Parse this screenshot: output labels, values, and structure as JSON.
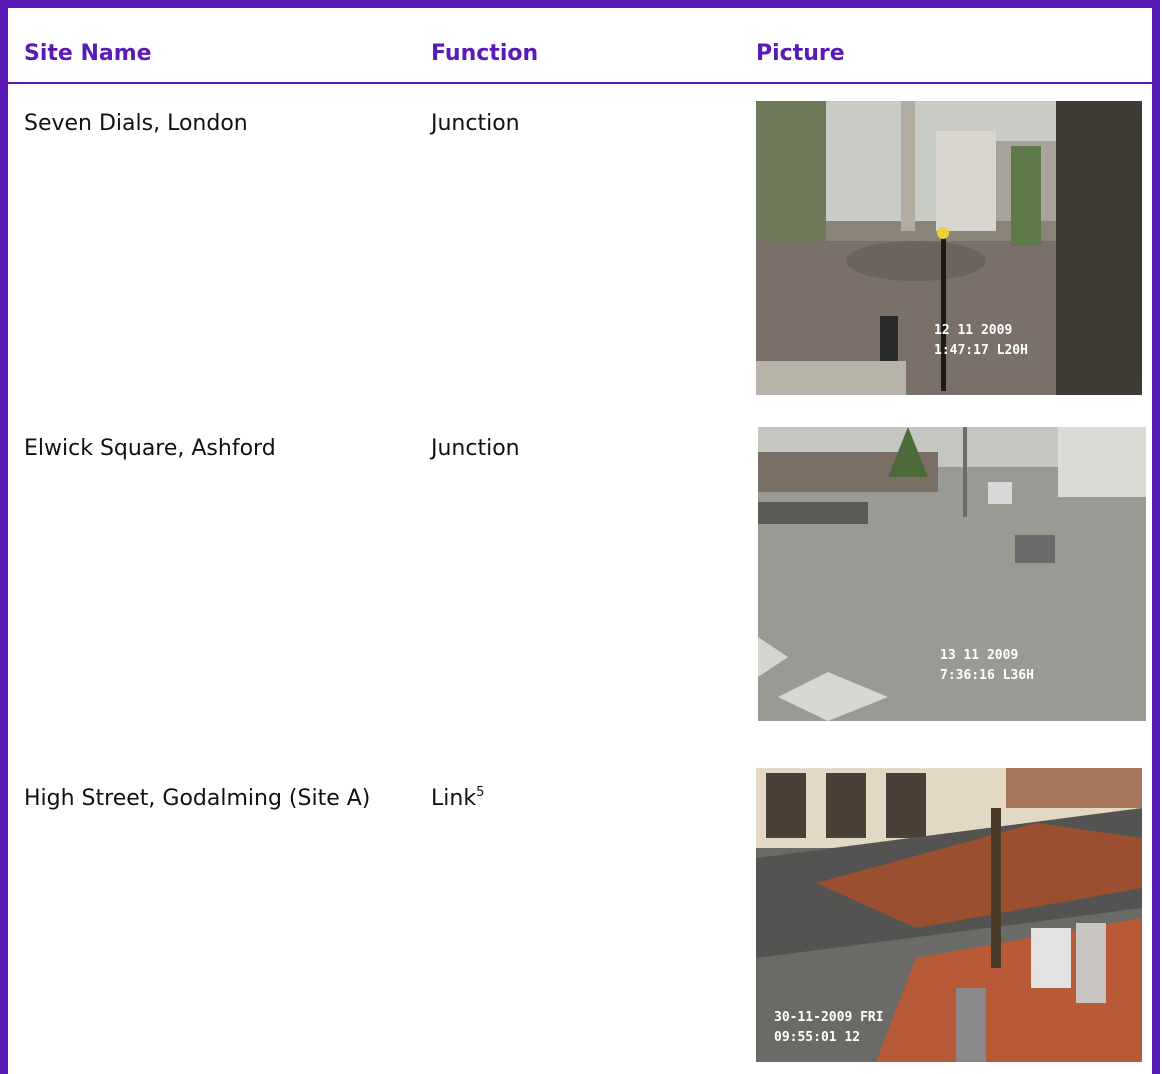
{
  "table": {
    "headers": {
      "site_name": "Site Name",
      "function": "Function",
      "picture": "Picture"
    },
    "rows": [
      {
        "site_name": "Seven Dials, London",
        "function": "Junction",
        "function_sup": "",
        "picture": {
          "stamp_line1": "12 11     2009",
          "stamp_line2": "1:47:17 L20H"
        }
      },
      {
        "site_name": "Elwick Square, Ashford",
        "function": "Junction",
        "function_sup": "",
        "picture": {
          "stamp_line1": "13 11     2009",
          "stamp_line2": "7:36:16 L36H"
        }
      },
      {
        "site_name": "High Street, Godalming (Site A)",
        "function": "Link",
        "function_sup": "5",
        "picture": {
          "stamp_line1": "30-11-2009 FRI",
          "stamp_line2": "09:55:01   12"
        }
      }
    ]
  },
  "colors": {
    "accent": "#5a1ab8",
    "text": "#111111"
  }
}
